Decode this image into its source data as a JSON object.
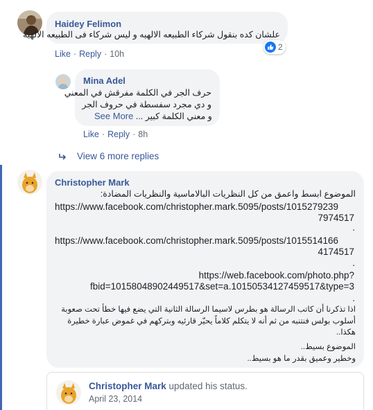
{
  "comments": [
    {
      "author": "Haidey Felimon",
      "lines": [
        "علشان كده بنقول شركاء الطبيعه الالهيه و ليس شركاء فى الطبيعه الالهيه"
      ],
      "reaction_count": "2",
      "actions": {
        "like": "Like",
        "reply": "Reply",
        "time": "10h"
      }
    }
  ],
  "reply": {
    "author": "Mina Adel",
    "lines": [
      "حرف الجر في الكلمة مفرقش في المعني",
      "و دي مجرد سفسطة في حروف الجر",
      "و معني الكلمة كبير"
    ],
    "see_more": "See More",
    "ellipsis": "...",
    "actions": {
      "like": "Like",
      "reply": "Reply",
      "time": "8h"
    }
  },
  "view_more_replies": "View 6 more replies",
  "main_comment": {
    "author": "Christopher Mark",
    "intro": "الموضوع ابسط واعمق من كل النظريات البالاماسية والنظريات المضادة:",
    "link1_a": "https://www.facebook.com/christopher.mark.5095/posts/1015279239",
    "link1_b": "7974517",
    "sep1": ".",
    "link2_a": "https://www.facebook.com/christopher.mark.5095/posts/1015514166",
    "link2_b": "4174517",
    "sep2": ".",
    "link3_a": "https://web.facebook.com/photo.php?",
    "link3_b": "fbid=10158048902449517&set=a.10150534127459517&type=3",
    "sep3": ".",
    "p1": "اذا تذكرنا أن كاتب الرسالة هو بطرس لاسيما الرسالة الثانية التي يضع فيها خطأ تحت صعوبة",
    "p2": "أسلوب بولس فنتنبه من ثم أنه لا يتكلم كلاماً يحيّر قارئيه وبتركهم في غموض عبارة خطيرة",
    "p3": "هكذا..",
    "p4": "الموضوع بسيط..",
    "p5": "وخطير وعميق بقدر ما هو بسيط.."
  },
  "shared_post": {
    "author": "Christopher Mark",
    "action": "updated his status.",
    "date": "April 23, 2014"
  },
  "colors": {
    "link": "#385898",
    "bubble": "#f2f3f5",
    "muted": "#606770",
    "accent": "#4267b2",
    "like_badge": "#1877f2"
  }
}
